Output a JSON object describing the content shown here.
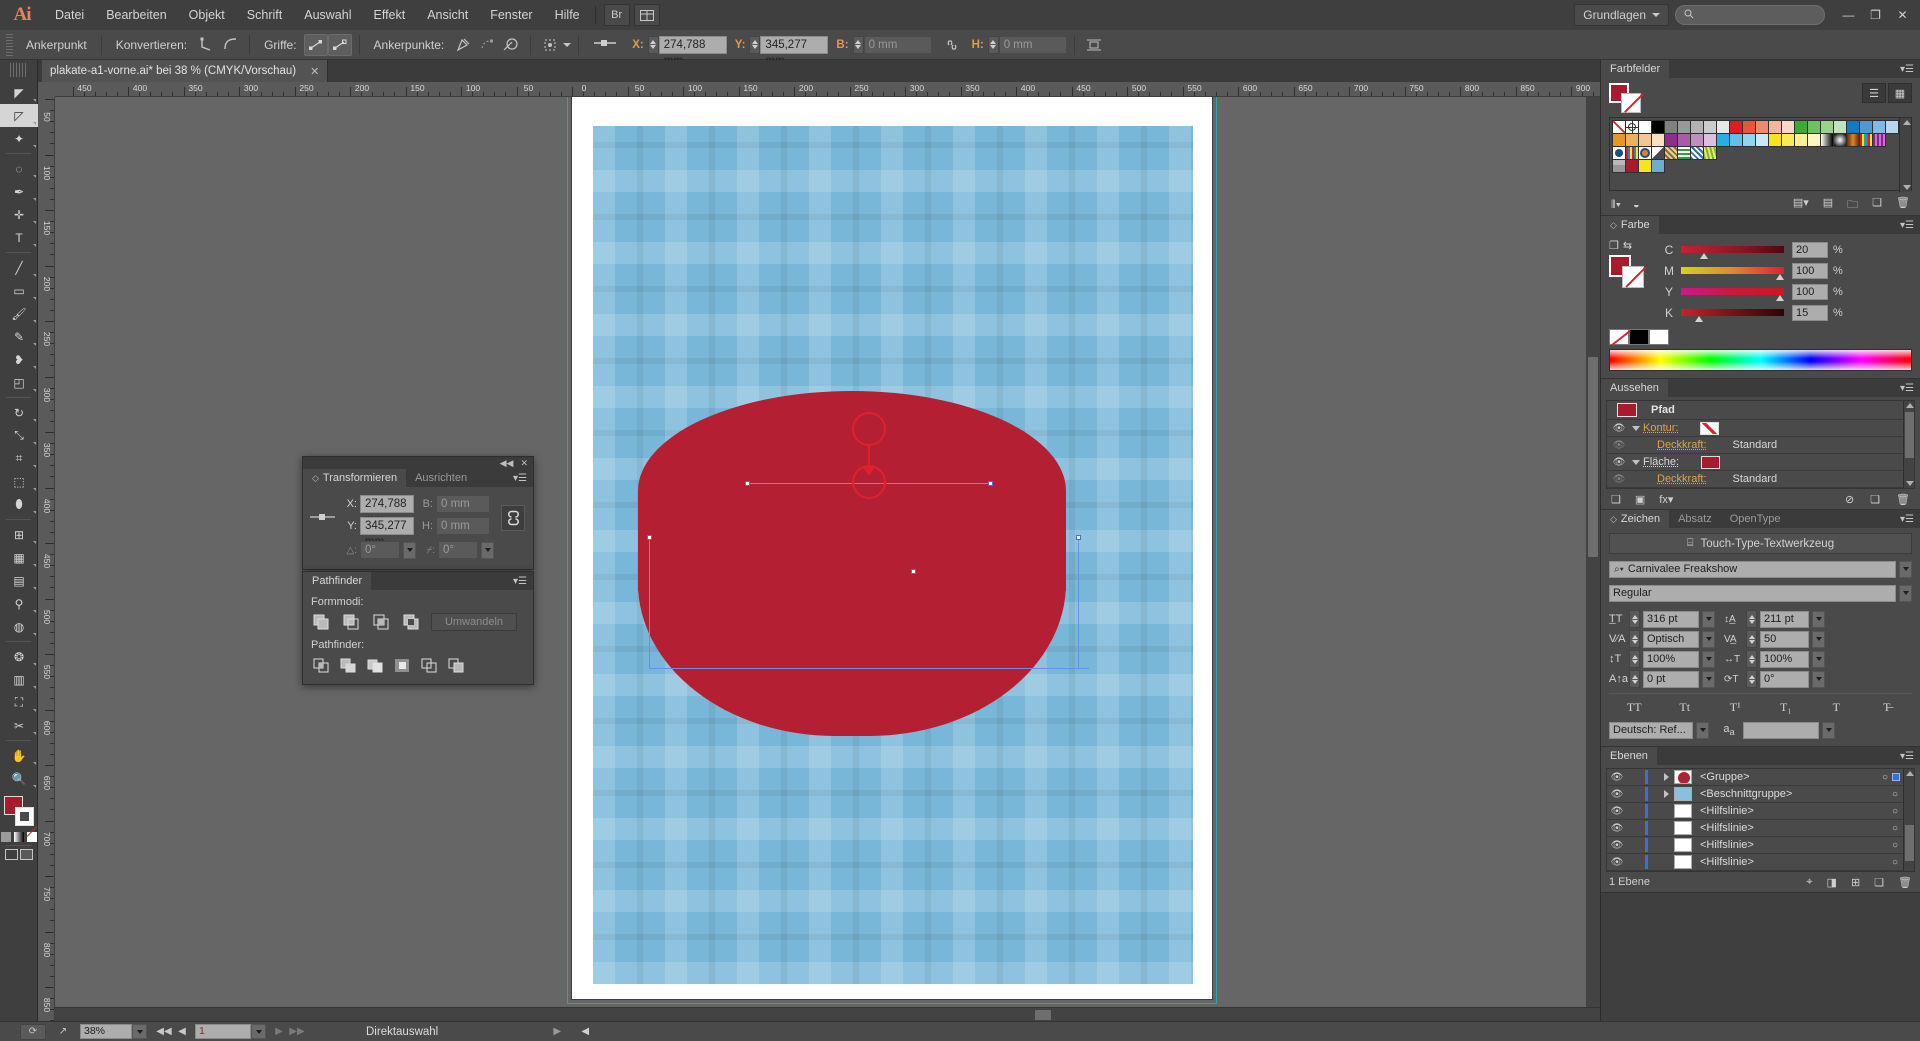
{
  "app": {
    "name": "Ai",
    "brand_color": "#e8825a"
  },
  "menubar": {
    "items": [
      "Datei",
      "Bearbeiten",
      "Objekt",
      "Schrift",
      "Auswahl",
      "Effekt",
      "Ansicht",
      "Fenster",
      "Hilfe"
    ],
    "bridge_label": "Br",
    "workspace": "Grundlagen",
    "search_placeholder": "",
    "window_minimize": "—",
    "window_restore": "❐",
    "window_close": "✕"
  },
  "controlbar": {
    "title": "Ankerpunkt",
    "convert_label": "Konvertieren:",
    "handles_label": "Griffe:",
    "anchors_label": "Ankerpunkte:",
    "x_label": "X:",
    "x_value": "274,788 mm",
    "y_label": "Y:",
    "y_value": "345,277 mm",
    "w_label": "B:",
    "w_value": "0 mm",
    "h_label": "H:",
    "h_value": "0 mm"
  },
  "document_tab": {
    "title": "plakate-a1-vorne.ai* bei 38 % (CMYK/Vorschau)",
    "close": "✕"
  },
  "toolbox": {
    "tools": [
      {
        "name": "selection-tool",
        "glyph": "◤"
      },
      {
        "name": "direct-selection-tool",
        "glyph": "◸"
      },
      {
        "name": "magic-wand-tool",
        "glyph": "✦"
      },
      {
        "name": "lasso-tool",
        "glyph": "◌"
      },
      {
        "name": "pen-tool",
        "glyph": "✒"
      },
      {
        "name": "add-anchor-point-tool",
        "glyph": "✛"
      },
      {
        "name": "type-tool",
        "glyph": "T"
      },
      {
        "name": "line-segment-tool",
        "glyph": "╱"
      },
      {
        "name": "rectangle-tool",
        "glyph": "▭"
      },
      {
        "name": "paintbrush-tool",
        "glyph": "🖌"
      },
      {
        "name": "pencil-tool",
        "glyph": "✎"
      },
      {
        "name": "blob-brush-tool",
        "glyph": "❥"
      },
      {
        "name": "eraser-tool",
        "glyph": "◰"
      },
      {
        "name": "rotate-tool",
        "glyph": "↻"
      },
      {
        "name": "scale-tool",
        "glyph": "⤡"
      },
      {
        "name": "width-tool",
        "glyph": "⌗"
      },
      {
        "name": "free-transform-tool",
        "glyph": "⬚"
      },
      {
        "name": "shape-builder-tool",
        "glyph": "⬮"
      },
      {
        "name": "perspective-grid-tool",
        "glyph": "⊞"
      },
      {
        "name": "mesh-tool",
        "glyph": "▦"
      },
      {
        "name": "gradient-tool",
        "glyph": "▤"
      },
      {
        "name": "eyedropper-tool",
        "glyph": "⚲"
      },
      {
        "name": "blend-tool",
        "glyph": "◍"
      },
      {
        "name": "symbol-sprayer-tool",
        "glyph": "❂"
      },
      {
        "name": "column-graph-tool",
        "glyph": "▥"
      },
      {
        "name": "artboard-tool",
        "glyph": "⛶"
      },
      {
        "name": "slice-tool",
        "glyph": "✂"
      },
      {
        "name": "hand-tool",
        "glyph": "✋"
      },
      {
        "name": "zoom-tool",
        "glyph": "🔍"
      }
    ]
  },
  "rulers": {
    "horizontal_labels": [
      "450",
      "400",
      "350",
      "300",
      "250",
      "200",
      "150",
      "100",
      "50",
      "0",
      "50",
      "100",
      "150",
      "200",
      "250",
      "300",
      "350",
      "400",
      "450",
      "500",
      "550",
      "600",
      "650",
      "700",
      "750",
      "800",
      "850",
      "900"
    ],
    "vertical_labels": [
      "50",
      "100",
      "150",
      "200",
      "250",
      "300",
      "350",
      "400",
      "450",
      "500",
      "550",
      "600",
      "650",
      "700",
      "750",
      "800",
      "850"
    ]
  },
  "transform_panel": {
    "collapse": "◀◀",
    "close": "✕",
    "tabs": [
      "Transformieren",
      "Ausrichten"
    ],
    "active_tab": "Transformieren",
    "x_label": "X:",
    "x_value": "274,788 mm",
    "y_label": "Y:",
    "y_value": "345,277 mm",
    "w_label": "B:",
    "w_value": "0 mm",
    "h_label": "H:",
    "h_value": "0 mm",
    "rotate_label": "△:",
    "rotate_value": "0°",
    "shear_label": "⌿:",
    "shear_value": "0°",
    "link_icon": "⛓"
  },
  "pathfinder_panel": {
    "tab": "Pathfinder",
    "shape_modes_label": "Formmodi:",
    "pathfinders_label": "Pathfinder:",
    "expand_button": "Umwandeln",
    "shape_modes": [
      "unite",
      "minus-front",
      "intersect",
      "exclude"
    ],
    "pathfinders": [
      "divide",
      "trim",
      "merge",
      "crop",
      "outline",
      "minus-back"
    ]
  },
  "swatches_panel": {
    "tab": "Farbfelder",
    "view_list_icon": "☰",
    "view_grid_icon": "▦",
    "footer_icons": [
      "swatch-libraries",
      "show-swatch-kinds",
      "swatch-options",
      "new-color-group",
      "new-swatch",
      "delete-swatch"
    ],
    "fill_color": "#a81b2e",
    "row1": [
      "none",
      "registration",
      "#ffffff",
      "#000000",
      "#808080",
      "#999999",
      "#b3b3b3",
      "#cccccc",
      "#e6e6e6",
      "#e01b24",
      "#e8573a",
      "#eb8b6e",
      "#f0b79e",
      "#f5d9c6",
      "#3ea832",
      "#6ec063",
      "#9ad18f",
      "#c4e3bc",
      "#1479c4",
      "#4f99d1",
      "#85b8de",
      "#b9d6ec"
    ],
    "row2": [
      "#e8952a",
      "#eeb05c",
      "#f3c78f",
      "#f8e0c2",
      "#8f2d8f",
      "#a85ca8",
      "#c28ec2",
      "#dcbfdc",
      "#27aee4",
      "#5ec1ea",
      "#92d5f0",
      "#c6e8f7",
      "#f5e61c",
      "#f8eb55",
      "#fbf18e",
      "#fdf7c6",
      "gradient-white-black",
      "gradient-radial",
      "gradient-orange",
      "pattern-rainbow",
      "pattern-stripe"
    ],
    "row3": [
      "pattern-circles",
      "pattern-lines",
      "pattern-dots",
      "pattern-diag",
      "pattern-leaf",
      "pattern-green-lines",
      "pattern-blue-net",
      "pattern-grass"
    ],
    "row4": [
      "folder",
      "#a81b2e",
      "#f5e61c",
      "#6aaed6"
    ]
  },
  "color_panel": {
    "tab": "Farbe",
    "sliders": [
      {
        "label": "C",
        "value": "20",
        "unit": "%",
        "pos": 20
      },
      {
        "label": "M",
        "value": "100",
        "unit": "%",
        "pos": 100
      },
      {
        "label": "Y",
        "value": "100",
        "unit": "%",
        "pos": 100
      },
      {
        "label": "K",
        "value": "15",
        "unit": "%",
        "pos": 15
      }
    ],
    "fill_color": "#a81b2e",
    "none_swatch": "none",
    "black_swatch": "#000000",
    "white_swatch": "#ffffff"
  },
  "appearance_panel": {
    "tab": "Aussehen",
    "object_type": "Pfad",
    "object_color": "#a81b2e",
    "rows": [
      {
        "label": "Kontur:",
        "value": "",
        "swatch": "none",
        "indent": 0,
        "has_eye": true,
        "has_triangle": true
      },
      {
        "label": "Deckkraft:",
        "value": "Standard",
        "swatch": "",
        "indent": 1,
        "has_eye": true,
        "has_triangle": false
      },
      {
        "label": "Fläche:",
        "value": "",
        "swatch": "#a81b2e",
        "indent": 0,
        "has_eye": true,
        "has_triangle": true
      },
      {
        "label": "Deckkraft:",
        "value": "Standard",
        "swatch": "",
        "indent": 1,
        "has_eye": true,
        "has_triangle": false
      }
    ],
    "footer_icons": [
      "add-new-stroke",
      "add-new-fill",
      "add-new-effect",
      "clear-appearance",
      "duplicate-item",
      "delete-item"
    ]
  },
  "character_panel": {
    "tabs": [
      "Zeichen",
      "Absatz",
      "OpenType"
    ],
    "active_tab": "Zeichen",
    "touch_type_label": "Touch-Type-Textwerkzeug",
    "font_family": "Carnivalee Freakshow",
    "font_style": "Regular",
    "font_size": "316 pt",
    "leading": "211 pt",
    "kerning": "Optisch",
    "tracking": "50",
    "vertical_scale": "100%",
    "horizontal_scale": "100%",
    "baseline_shift": "0 pt",
    "character_rotation": "0°",
    "style_buttons": [
      "TT",
      "Tt",
      "T¹",
      "T₁",
      "T",
      "T̶"
    ],
    "language": "Deutsch: Ref...",
    "anti_alias": ""
  },
  "layers_panel": {
    "tab": "Ebenen",
    "rows": [
      {
        "name": "<Gruppe>",
        "thumb": "#b51f33",
        "has_arrow": true,
        "selected": true
      },
      {
        "name": "<Beschnittgruppe>",
        "thumb": "#88c0e0",
        "has_arrow": true,
        "selected": false
      },
      {
        "name": "<Hilfslinie>",
        "thumb": "#ffffff",
        "has_arrow": false,
        "selected": false
      },
      {
        "name": "<Hilfslinie>",
        "thumb": "#ffffff",
        "has_arrow": false,
        "selected": false
      },
      {
        "name": "<Hilfslinie>",
        "thumb": "#ffffff",
        "has_arrow": false,
        "selected": false
      },
      {
        "name": "<Hilfslinie>",
        "thumb": "#ffffff",
        "has_arrow": false,
        "selected": false
      }
    ],
    "footer_label": "1 Ebene",
    "footer_icons": [
      "locate-object",
      "make-clipping-mask",
      "create-new-sublayer",
      "create-new-layer",
      "delete-selection"
    ]
  },
  "statusbar": {
    "zoom_value": "38%",
    "artboard_value": "1",
    "tool_status": "Direktauswahl",
    "first_icon": "⟳",
    "share_icon": "↗",
    "nav_first": "◀◀",
    "nav_prev": "◀",
    "nav_next": "▶",
    "nav_last": "▶▶",
    "status_arrow": "▶",
    "scroll_arrow": "◀"
  },
  "canvas": {
    "shape_fill": "#b51f33",
    "background_fill": "#79b7d8",
    "guide_color": "#6b8fe8",
    "selection_red": "#e0202e"
  }
}
